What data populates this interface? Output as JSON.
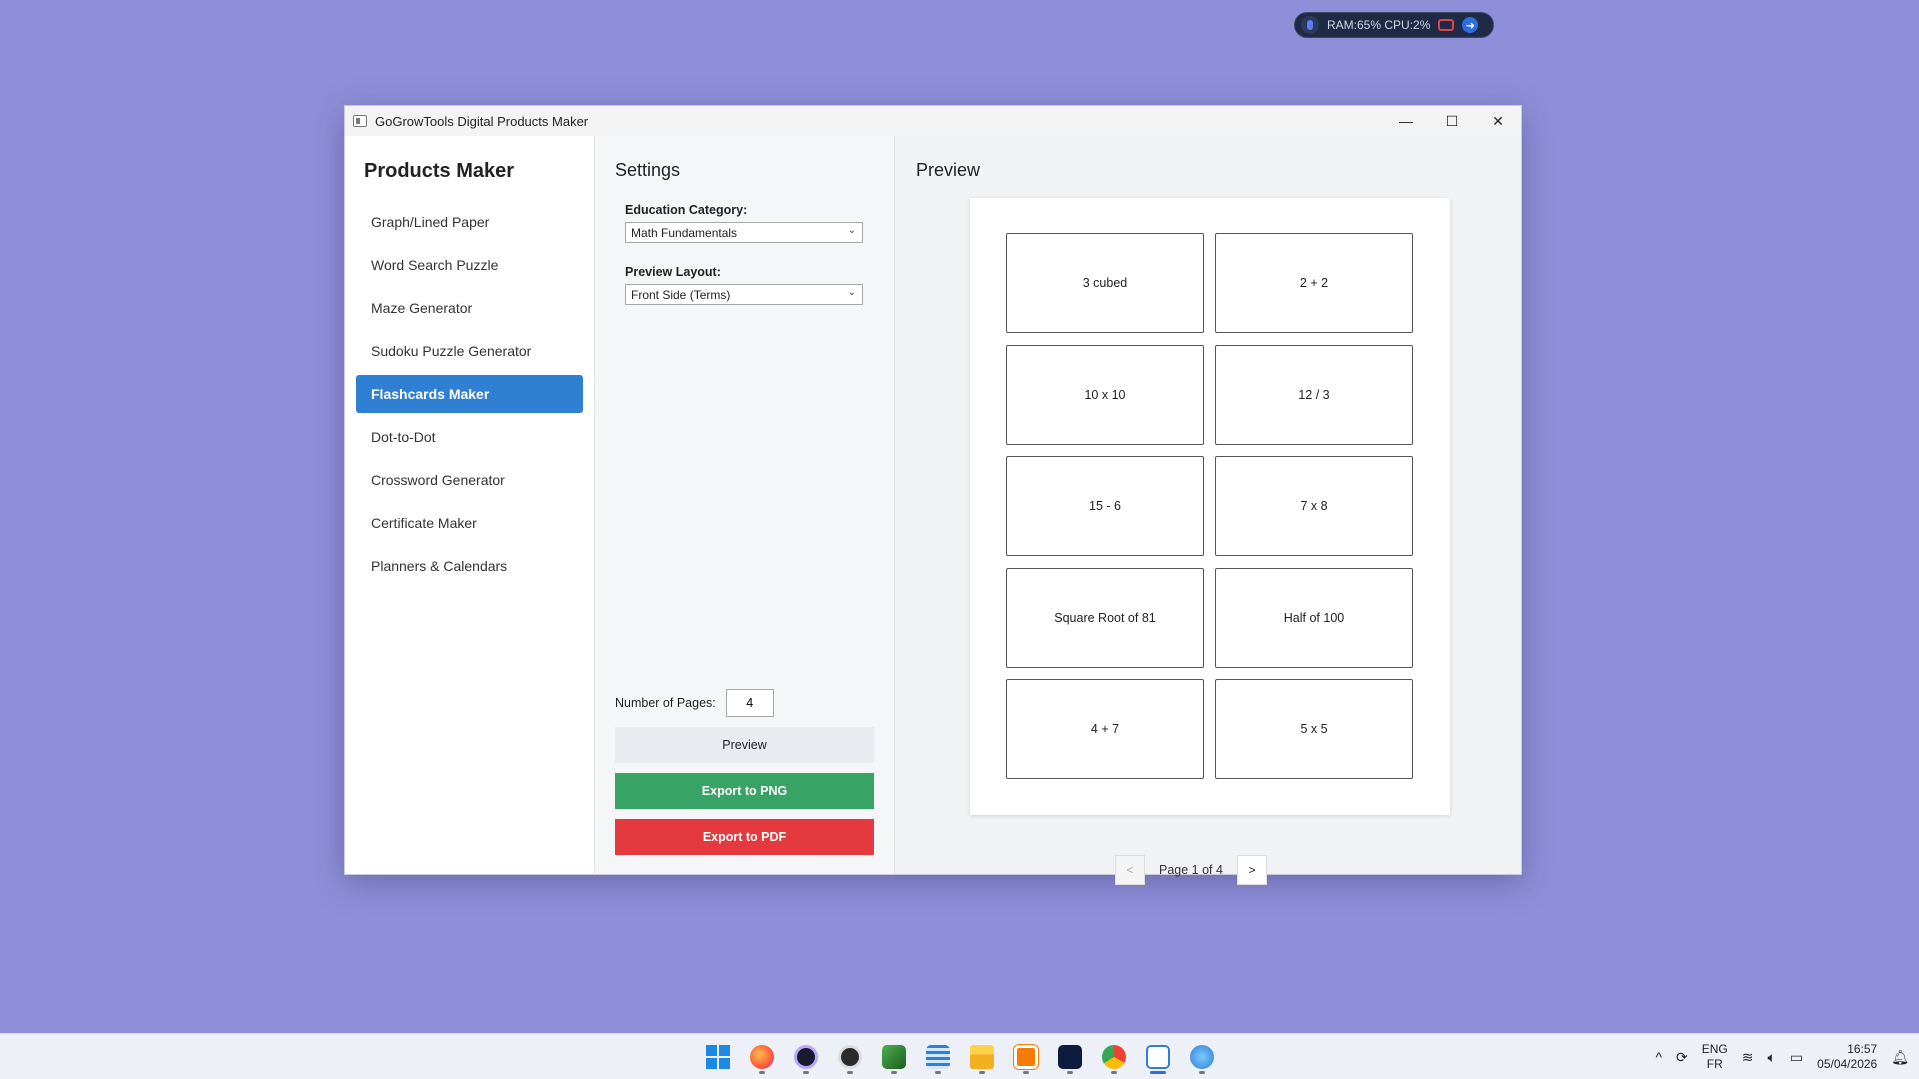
{
  "sysmon": {
    "text": "RAM:65%  CPU:2%"
  },
  "window": {
    "title": "GoGrowTools Digital Products Maker",
    "controls": {
      "minimize": "—",
      "maximize": "☐",
      "close": "✕"
    }
  },
  "sidebar": {
    "heading": "Products Maker",
    "items": [
      {
        "label": "Graph/Lined Paper"
      },
      {
        "label": "Word Search Puzzle"
      },
      {
        "label": "Maze Generator"
      },
      {
        "label": "Sudoku Puzzle Generator"
      },
      {
        "label": "Flashcards Maker"
      },
      {
        "label": "Dot-to-Dot"
      },
      {
        "label": "Crossword Generator"
      },
      {
        "label": "Certificate Maker"
      },
      {
        "label": "Planners & Calendars"
      }
    ],
    "active_index": 4
  },
  "settings": {
    "heading": "Settings",
    "education_category": {
      "label": "Education Category:",
      "value": "Math Fundamentals"
    },
    "preview_layout": {
      "label": "Preview Layout:",
      "value": "Front Side (Terms)"
    },
    "pages": {
      "label": "Number of Pages:",
      "value": "4"
    },
    "buttons": {
      "preview": "Preview",
      "export_png": "Export to PNG",
      "export_pdf": "Export to PDF"
    }
  },
  "preview": {
    "heading": "Preview",
    "cards": [
      "3 cubed",
      "2 + 2",
      "10 x 10",
      "12 / 3",
      "15 - 6",
      "7 x 8",
      "Square Root of 81",
      "Half of 100",
      "4 + 7",
      "5 x 5"
    ],
    "pager": {
      "prev": "<",
      "label": "Page 1 of 4",
      "next": ">"
    }
  },
  "taskbar": {
    "apps": [
      "start-icon",
      "firefox-icon",
      "app-icon",
      "obs-icon",
      "editor-icon",
      "notepad-icon",
      "file-explorer-icon",
      "xampp-icon",
      "terminal-icon",
      "chrome-icon",
      "products-maker-icon",
      "network-icon"
    ],
    "tray": {
      "chevron": "^",
      "lang_top": "ENG",
      "lang_bottom": "FR",
      "time": "16:57",
      "date": "05/04/2026"
    }
  },
  "colors": {
    "desktop": "#8f8fd9",
    "accent": "#2f80d3",
    "export_png": "#37a466",
    "export_pdf": "#e3393f"
  }
}
